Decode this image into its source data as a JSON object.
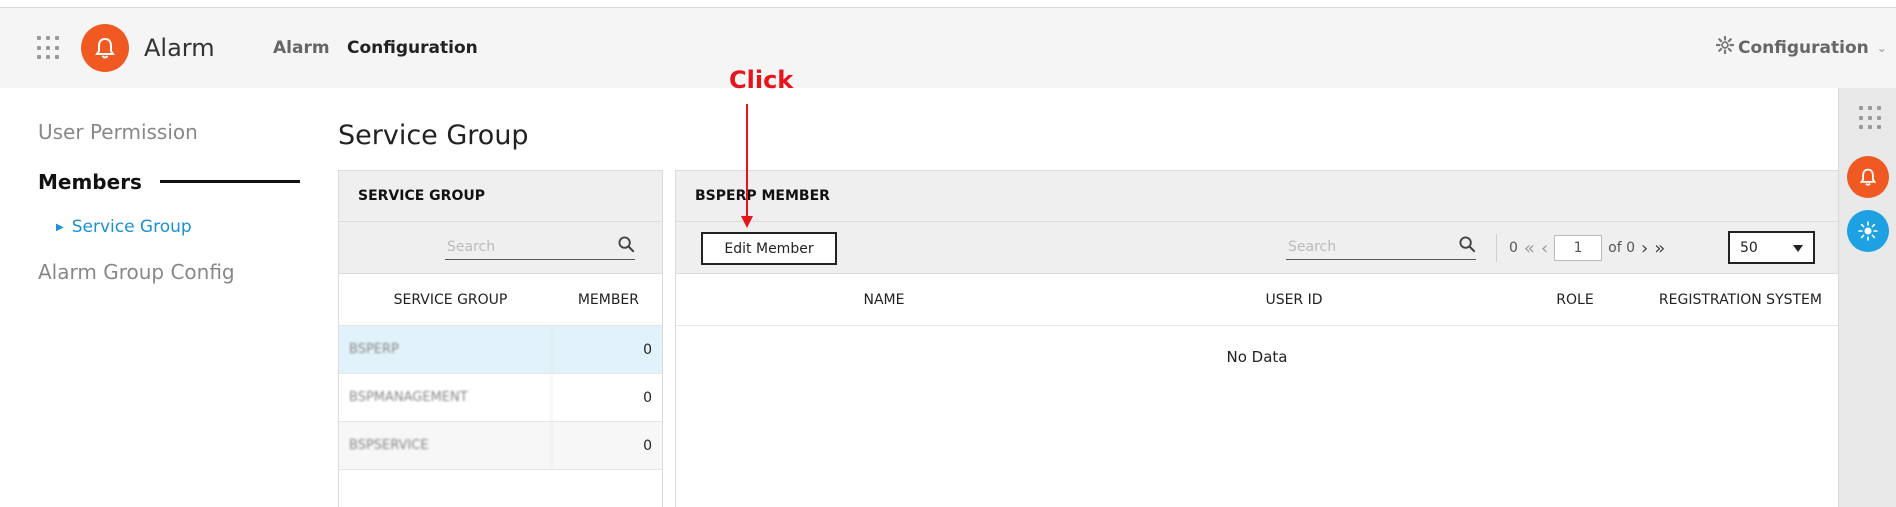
{
  "header": {
    "app_title": "Alarm",
    "nav": [
      "Alarm",
      "Configuration"
    ],
    "config_menu_label": "Configuration"
  },
  "sidebar": {
    "user_permission": "User Permission",
    "members": "Members",
    "service_group": "Service Group",
    "alarm_group_config": "Alarm Group Config"
  },
  "page": {
    "title": "Service Group"
  },
  "service_group_panel": {
    "header": "SERVICE GROUP",
    "search_placeholder": "Search",
    "columns": [
      "SERVICE GROUP",
      "MEMBER"
    ],
    "rows": [
      {
        "name": "BSPERP",
        "member": "0"
      },
      {
        "name": "BSPMANAGEMENT",
        "member": "0"
      },
      {
        "name": "BSPSERVICE",
        "member": "0"
      }
    ]
  },
  "member_panel": {
    "header": "BSPERP MEMBER",
    "edit_button": "Edit Member",
    "search_placeholder": "Search",
    "pager": {
      "total": "0",
      "current_page": "1",
      "of_label": "of 0",
      "page_size": "50"
    },
    "columns": [
      "NAME",
      "USER ID",
      "ROLE",
      "REGISTRATION SYSTEM"
    ],
    "empty_text": "No Data"
  },
  "annotation": {
    "label": "Click",
    "color": "#e8141c"
  },
  "colors": {
    "brand_orange": "#f05a22",
    "link_blue": "#1a90d2",
    "selected_row": "#e2f2fa",
    "weather_blue": "#1ea1e3"
  },
  "icons": {
    "apps": "apps-grid-icon",
    "logo": "bell-icon",
    "settings": "gear-icon",
    "search": "search-icon",
    "weather": "weather-icon"
  }
}
